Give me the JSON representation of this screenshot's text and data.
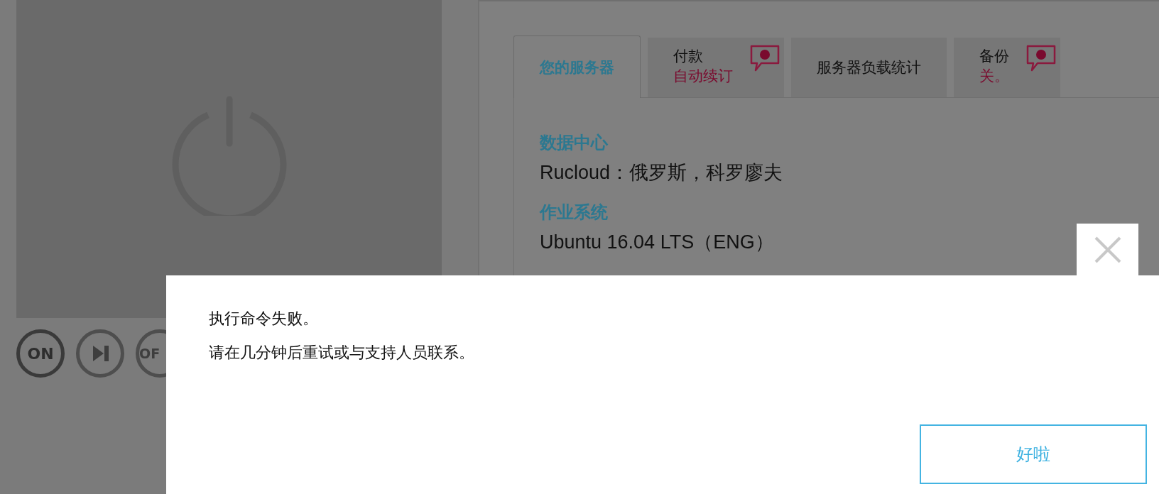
{
  "server_controls": [
    {
      "kind": "text",
      "label": "ON",
      "active": true
    },
    {
      "kind": "next",
      "active": false
    },
    {
      "kind": "text",
      "label": "OF",
      "active": false
    }
  ],
  "tabs": [
    {
      "title": "您的服务器",
      "selected": true,
      "alert": false
    },
    {
      "title": "付款",
      "status": "自动续订",
      "selected": false,
      "alert": true
    },
    {
      "title": "服务器负载统计",
      "selected": false,
      "alert": false
    },
    {
      "title": "备份",
      "status": "关。",
      "selected": false,
      "alert": true
    }
  ],
  "details": [
    {
      "label": "数据中心",
      "value": "Rucloud：俄罗斯，科罗廖夫"
    },
    {
      "label": "作业系统",
      "value": "Ubuntu 16.04 LTS（ENG）"
    }
  ],
  "dialog": {
    "lines": [
      "执行命令失败。",
      "请在几分钟后重试或与支持人员联系。"
    ],
    "button": "好啦"
  }
}
